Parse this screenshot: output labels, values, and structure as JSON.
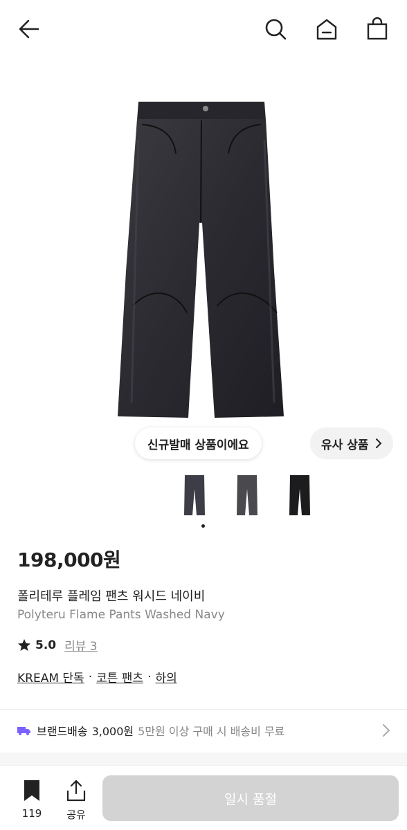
{
  "header": {
    "back_icon": "arrow-left-icon",
    "search_icon": "search-icon",
    "home_icon": "home-icon",
    "bag_icon": "shopping-bag-icon"
  },
  "product": {
    "image": "black-wide-leg-pants",
    "new_release_badge": "신규발매 상품이에요",
    "similar_label": "유사 상품",
    "thumbnails": [
      "navy-pants-front",
      "grey-pants-front",
      "black-pants-front"
    ],
    "price": "198,000원",
    "name_ko": "폴리테루 플레임 팬츠 워시드 네이비",
    "name_en": "Polyteru Flame Pants Washed Navy",
    "rating_score": "5.0",
    "review_label": "리뷰 3",
    "tags": [
      "KREAM 단독",
      "코튼 팬츠",
      "하의"
    ]
  },
  "shipping": {
    "label": "브랜드배송",
    "fee": "3,000원",
    "note": "5만원 이상 구매 시 배송비 무료"
  },
  "bottom_bar": {
    "bookmark_count": "119",
    "share_label": "공유",
    "cta_label": "일시 품절"
  },
  "colors": {
    "accent_shipping": "#7b61ff",
    "disabled_button": "#d3d3d3"
  }
}
